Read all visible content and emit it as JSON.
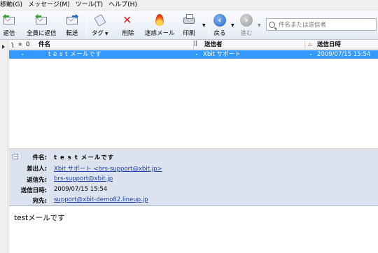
{
  "menu": [
    "移動(G)",
    "メッセージ(M)",
    "ツール(T)",
    "ヘルプ(H)"
  ],
  "toolbar": {
    "reply": "返信",
    "reply_all": "全員に返信",
    "forward": "転送",
    "tag": "タグ",
    "delete": "削除",
    "junk": "迷惑メール",
    "print": "印刷",
    "back": "戻る",
    "next": "進む",
    "search_placeholder": "件名または送信者"
  },
  "columns": {
    "subject": "件名",
    "from": "送信者",
    "date": "送信日時"
  },
  "messages": [
    {
      "subject": "t e s t メールです",
      "from": "Xbit サポート",
      "date": "2009/07/15 15:54",
      "selected": true
    }
  ],
  "header": {
    "subject_label": "件名:",
    "subject": "t e s t メールです",
    "from_label": "差出人:",
    "from": "Xbit サポート <brs-support@xbit.jp>",
    "reply_to_label": "返信先:",
    "reply_to": "brs-support@xbit.jp",
    "date_label": "送信日時:",
    "date": "2009/07/15 15:54",
    "to_label": "宛先:",
    "to": "support@xbit-demo82.lineup.jp"
  },
  "body_text": "testメールです",
  "colors": {
    "selection": "#3399ff",
    "header_bg": "#dde3ee",
    "link": "#1a3fb0"
  }
}
